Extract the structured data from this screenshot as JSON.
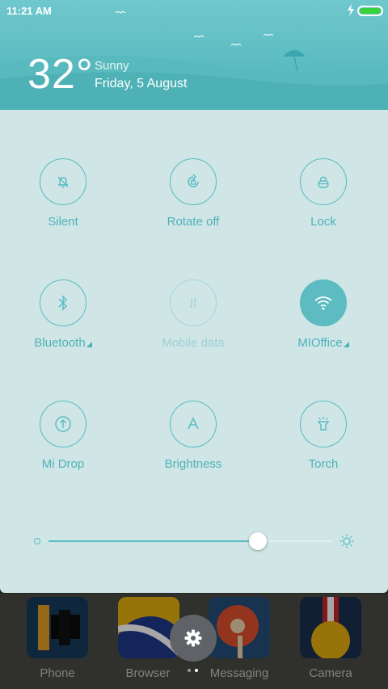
{
  "status_bar": {
    "time": "11:21 AM",
    "battery_color": "#36d23a"
  },
  "weather": {
    "temperature": "32°",
    "condition": "Sunny",
    "date": "Friday, 5 August"
  },
  "toggles": [
    {
      "label": "Silent",
      "icon": "bell-off-icon",
      "state": "off"
    },
    {
      "label": "Rotate off",
      "icon": "rotate-lock-icon",
      "state": "off"
    },
    {
      "label": "Lock",
      "icon": "lock-icon",
      "state": "off"
    },
    {
      "label": "Bluetooth",
      "icon": "bluetooth-icon",
      "state": "off",
      "has_menu": true
    },
    {
      "label": "Mobile data",
      "icon": "mobile-data-icon",
      "state": "disabled"
    },
    {
      "label": "MIOffice",
      "icon": "wifi-icon",
      "state": "on",
      "has_menu": true
    },
    {
      "label": "Mi Drop",
      "icon": "mi-drop-icon",
      "state": "off"
    },
    {
      "label": "Brightness",
      "icon": "auto-brightness-icon",
      "state": "off"
    },
    {
      "label": "Torch",
      "icon": "torch-icon",
      "state": "off"
    }
  ],
  "brightness": {
    "level": 0.74
  },
  "home_apps": [
    {
      "label": "Phone"
    },
    {
      "label": "Browser"
    },
    {
      "label": "Messaging"
    },
    {
      "label": "Camera"
    }
  ],
  "pager": {
    "pages": 2,
    "current": 2
  },
  "colors": {
    "accent": "#58bcc2",
    "panel": "#cfe5e6",
    "header": "#5dbdc2"
  }
}
